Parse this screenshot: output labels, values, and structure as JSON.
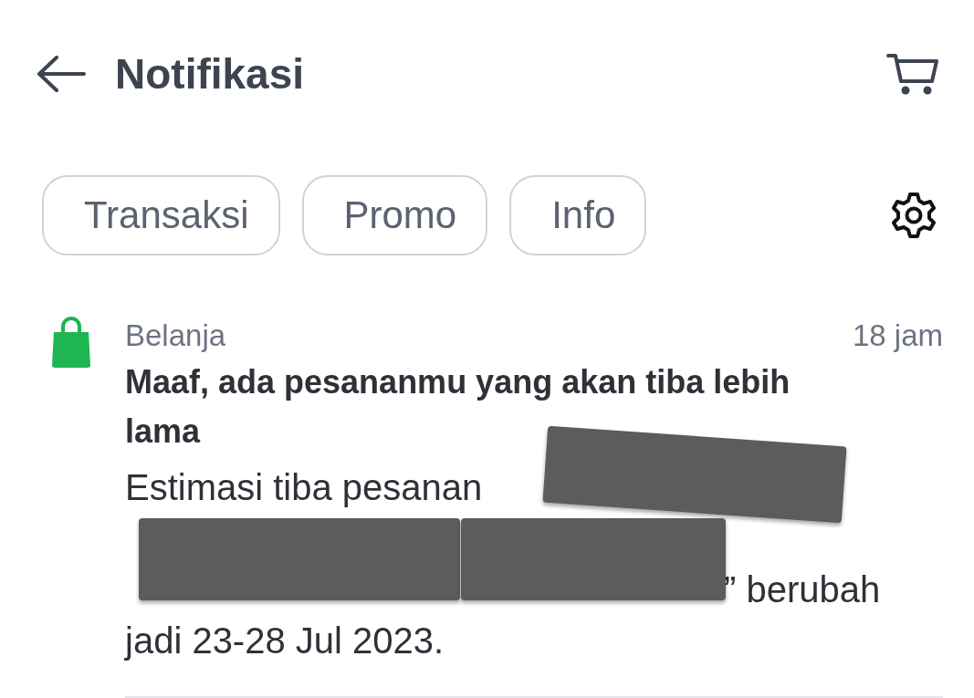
{
  "header": {
    "title": "Notifikasi"
  },
  "tabs": [
    {
      "label": "Transaksi",
      "selected": false
    },
    {
      "label": "Promo",
      "selected": false
    },
    {
      "label": "Info",
      "selected": false
    }
  ],
  "notification": {
    "category": "Belanja",
    "time": "18 jam",
    "title": "Maaf, ada pesananmu yang akan tiba lebih lama",
    "body_lines": [
      {
        "kind": "text",
        "text": "Estimasi tiba pesanan"
      },
      {
        "kind": "hidden"
      },
      {
        "kind": "after-redaction",
        "text": "” berubah"
      },
      {
        "kind": "text",
        "text": "jadi 23-28 Jul 2023."
      }
    ]
  }
}
